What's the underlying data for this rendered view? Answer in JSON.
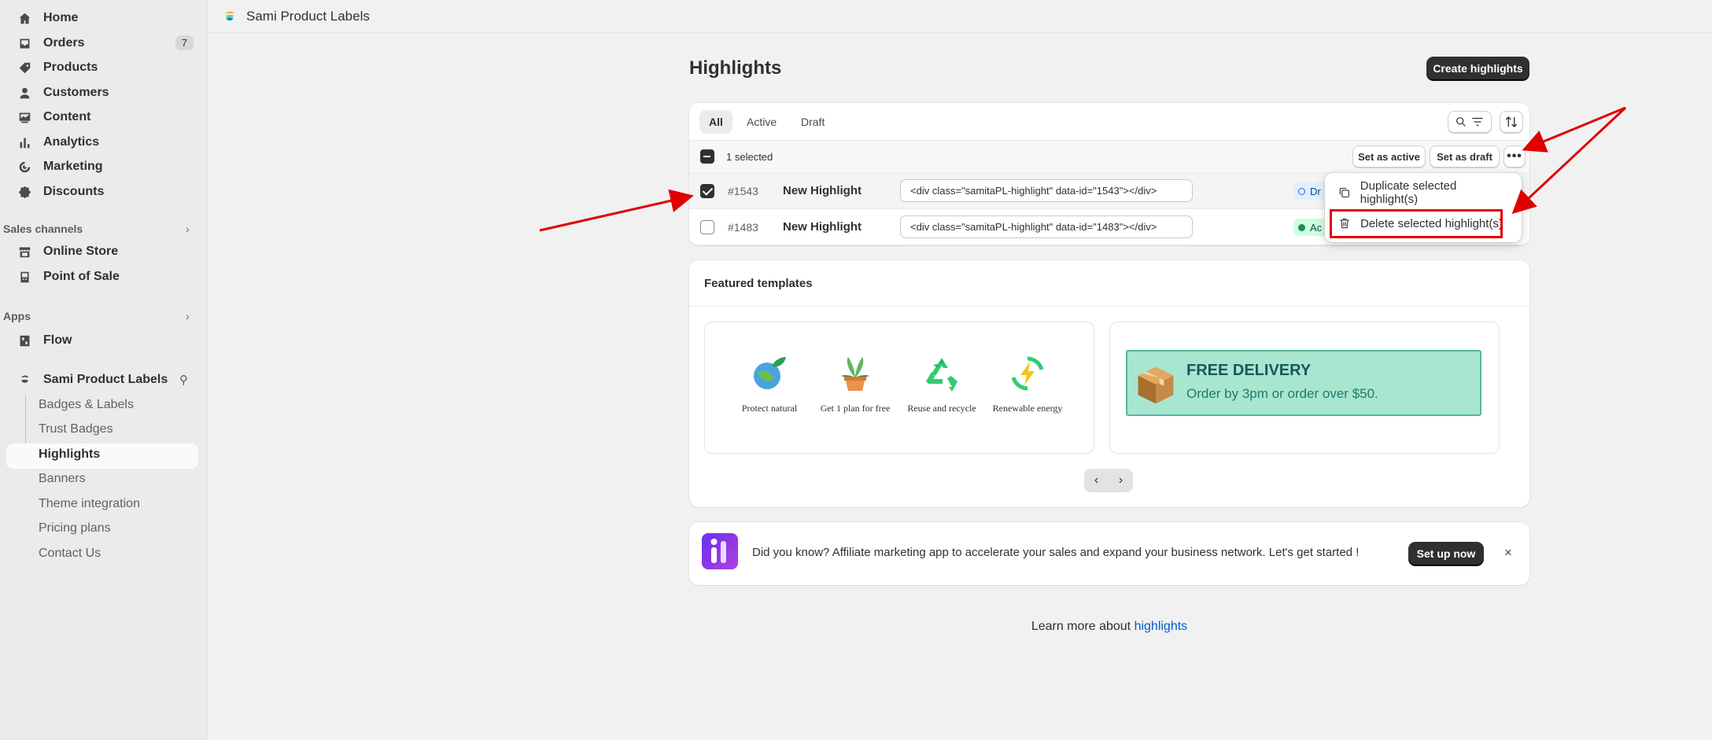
{
  "sidebar": {
    "nav": [
      {
        "label": "Home",
        "icon": "home-icon"
      },
      {
        "label": "Orders",
        "icon": "inbox-icon",
        "badge": "7"
      },
      {
        "label": "Products",
        "icon": "tag-icon"
      },
      {
        "label": "Customers",
        "icon": "person-icon"
      },
      {
        "label": "Content",
        "icon": "image-icon"
      },
      {
        "label": "Analytics",
        "icon": "bar-chart-icon"
      },
      {
        "label": "Marketing",
        "icon": "target-icon"
      },
      {
        "label": "Discounts",
        "icon": "discount-icon"
      }
    ],
    "sales_channels_label": "Sales channels",
    "sales_channels": [
      {
        "label": "Online Store",
        "icon": "store-icon"
      },
      {
        "label": "Point of Sale",
        "icon": "pos-icon"
      }
    ],
    "apps_label": "Apps",
    "apps": [
      {
        "label": "Flow",
        "icon": "flow-icon"
      },
      {
        "label": "Sami Product Labels",
        "icon": "sami-logo-icon"
      }
    ],
    "sub_items": [
      "Badges & Labels",
      "Trust Badges",
      "Highlights",
      "Banners",
      "Theme integration",
      "Pricing plans",
      "Contact Us"
    ]
  },
  "topbar": {
    "title": "Sami Product Labels"
  },
  "page": {
    "title": "Highlights",
    "create_button": "Create highlights",
    "tabs": [
      "All",
      "Active",
      "Draft"
    ],
    "bulk": {
      "selected_text": "1 selected",
      "set_active": "Set as active",
      "set_draft": "Set as draft"
    },
    "rows": [
      {
        "id": "#1543",
        "name": "New Highlight",
        "code": "<div class=\"samitaPL-highlight\" data-id=\"1543\"></div>",
        "status": "Dr"
      },
      {
        "id": "#1483",
        "name": "New Highlight",
        "code": "<div class=\"samitaPL-highlight\" data-id=\"1483\"></div>",
        "status": "Ac"
      }
    ],
    "menu": {
      "duplicate": "Duplicate selected highlight(s)",
      "delete": "Delete selected highlight(s)"
    }
  },
  "featured": {
    "title": "Featured templates",
    "highlights": [
      "Protect natural",
      "Get 1 plan for free",
      "Reuse and recycle",
      "Renewable energy"
    ],
    "delivery": {
      "title": "FREE DELIVERY",
      "subtitle": "Order by 3pm or order over $50."
    }
  },
  "promo": {
    "text": "Did you know? Affiliate marketing app to accelerate your sales and expand your business network. Let's get started !",
    "button": "Set up now",
    "close": "×"
  },
  "footer": {
    "prefix": "Learn more about ",
    "link": "highlights"
  },
  "colors": {
    "accent": "#303030",
    "annotation": "#e00000",
    "link": "#005bd3"
  }
}
